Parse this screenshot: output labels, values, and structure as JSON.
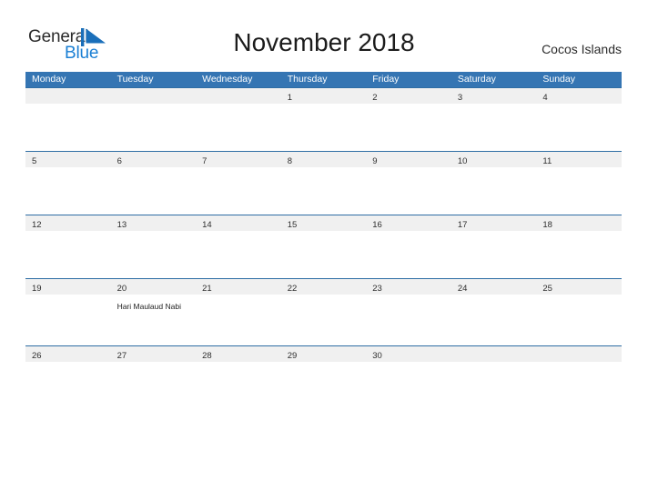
{
  "brand": {
    "name_part1": "General",
    "name_part2": "Blue",
    "mark_icon": "pennant-triangle-icon",
    "color_dark": "#2b2b2b",
    "color_blue": "#1a7fd4"
  },
  "header": {
    "title": "November 2018",
    "locale": "Cocos Islands"
  },
  "theme": {
    "header_row_bg": "#3575b3",
    "week_rule": "#2e6da4",
    "day_strip_bg": "#f0f0f0",
    "page_bg": "#ffffff"
  },
  "calendar": {
    "month": "November",
    "year": "2018",
    "weekday_headers": [
      "Monday",
      "Tuesday",
      "Wednesday",
      "Thursday",
      "Friday",
      "Saturday",
      "Sunday"
    ],
    "weeks": [
      {
        "days": [
          {
            "num": "",
            "event": ""
          },
          {
            "num": "",
            "event": ""
          },
          {
            "num": "",
            "event": ""
          },
          {
            "num": "1",
            "event": ""
          },
          {
            "num": "2",
            "event": ""
          },
          {
            "num": "3",
            "event": ""
          },
          {
            "num": "4",
            "event": ""
          }
        ]
      },
      {
        "days": [
          {
            "num": "5",
            "event": ""
          },
          {
            "num": "6",
            "event": ""
          },
          {
            "num": "7",
            "event": ""
          },
          {
            "num": "8",
            "event": ""
          },
          {
            "num": "9",
            "event": ""
          },
          {
            "num": "10",
            "event": ""
          },
          {
            "num": "11",
            "event": ""
          }
        ]
      },
      {
        "days": [
          {
            "num": "12",
            "event": ""
          },
          {
            "num": "13",
            "event": ""
          },
          {
            "num": "14",
            "event": ""
          },
          {
            "num": "15",
            "event": ""
          },
          {
            "num": "16",
            "event": ""
          },
          {
            "num": "17",
            "event": ""
          },
          {
            "num": "18",
            "event": ""
          }
        ]
      },
      {
        "days": [
          {
            "num": "19",
            "event": ""
          },
          {
            "num": "20",
            "event": "Hari Maulaud Nabi"
          },
          {
            "num": "21",
            "event": ""
          },
          {
            "num": "22",
            "event": ""
          },
          {
            "num": "23",
            "event": ""
          },
          {
            "num": "24",
            "event": ""
          },
          {
            "num": "25",
            "event": ""
          }
        ]
      },
      {
        "days": [
          {
            "num": "26",
            "event": ""
          },
          {
            "num": "27",
            "event": ""
          },
          {
            "num": "28",
            "event": ""
          },
          {
            "num": "29",
            "event": ""
          },
          {
            "num": "30",
            "event": ""
          },
          {
            "num": "",
            "event": ""
          },
          {
            "num": "",
            "event": ""
          }
        ]
      }
    ]
  }
}
